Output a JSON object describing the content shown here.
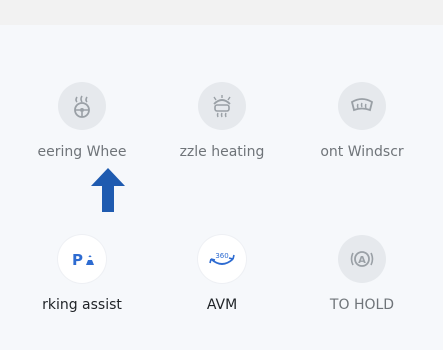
{
  "colors": {
    "panel_bg": "#f6f8fb",
    "icon_inactive": "#9aa0a6",
    "icon_active_blue": "#2d6bd1",
    "arrow_blue": "#1f5bb0"
  },
  "row1": [
    {
      "label": "eering Whee",
      "icon": "steering-wheel-heat-icon",
      "state": "off"
    },
    {
      "label": "zzle heating",
      "icon": "nozzle-heating-icon",
      "state": "off"
    },
    {
      "label": "ont Windscr",
      "icon": "front-windscreen-defrost-icon",
      "state": "off"
    }
  ],
  "row2": [
    {
      "label": "rking assist",
      "icon": "parking-assist-icon",
      "icon_text": "P",
      "state": "on"
    },
    {
      "label": "AVM",
      "icon": "avm-360-icon",
      "icon_text": "360",
      "state": "on"
    },
    {
      "label": "TO HOLD",
      "icon": "auto-hold-icon",
      "icon_text": "A",
      "state": "off"
    }
  ],
  "overlay": {
    "icon": "up-arrow-pointer-icon"
  }
}
